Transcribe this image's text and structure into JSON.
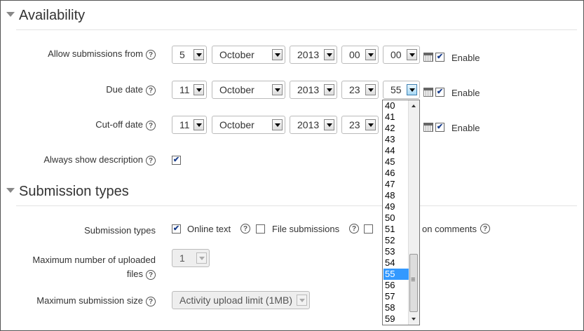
{
  "availability": {
    "title": "Availability",
    "allow_from": {
      "label": "Allow submissions from",
      "day": "5",
      "month": "October",
      "year": "2013",
      "hour": "00",
      "minute": "00",
      "enable": "Enable"
    },
    "due": {
      "label": "Due date",
      "day": "11",
      "month": "October",
      "year": "2013",
      "hour": "23",
      "minute": "55",
      "enable": "Enable"
    },
    "cutoff": {
      "label": "Cut-off date",
      "day": "11",
      "month": "October",
      "year": "2013",
      "hour": "23",
      "enable": "Enable"
    },
    "always_show": {
      "label": "Always show description"
    }
  },
  "submission": {
    "title": "Submission types",
    "types_label": "Submission types",
    "online_text": "Online text",
    "file_submissions": "File submissions",
    "comments_partial": "on comments",
    "max_files_label_1": "Maximum number of uploaded",
    "max_files_label_2": "files",
    "max_files_value": "1",
    "max_size_label": "Maximum submission size",
    "max_size_value": "Activity upload limit (1MB)"
  },
  "minute_dropdown": {
    "options": [
      "40",
      "41",
      "42",
      "43",
      "44",
      "45",
      "46",
      "47",
      "48",
      "49",
      "50",
      "51",
      "52",
      "53",
      "54",
      "55",
      "56",
      "57",
      "58",
      "59"
    ],
    "selected": "55"
  },
  "help_glyph": "?"
}
